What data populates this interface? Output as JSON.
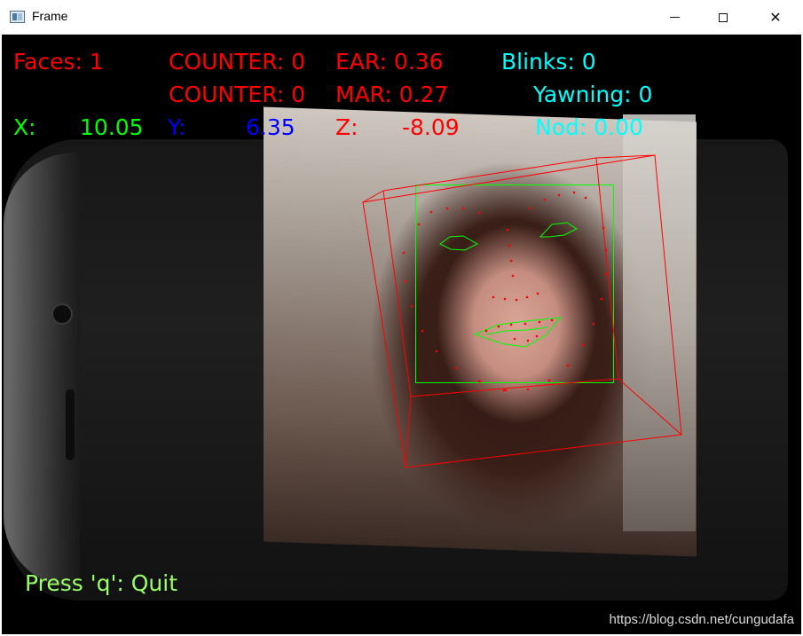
{
  "window": {
    "title": "Frame",
    "minimize_label": "minimize",
    "maximize_label": "maximize",
    "close_label": "✕"
  },
  "overlay": {
    "faces": "Faces: 1",
    "counter_ear": "COUNTER: 0",
    "ear": "EAR: 0.36",
    "blinks": "Blinks: 0",
    "counter_mar": "COUNTER: 0",
    "mar": "MAR: 0.27",
    "yawning": "Yawning: 0",
    "x_label": "X:",
    "x_value": "10.05",
    "y_label": "Y:",
    "y_value": "6.35",
    "z_label": "Z:",
    "z_value": "-8.09",
    "nod": "Nod: 0.00",
    "quit_hint": "Press 'q': Quit"
  },
  "watermark": "https://blog.csdn.net/cungudafa",
  "colors": {
    "red": "#ff0000",
    "green": "#00ff00",
    "blue": "#0000ff",
    "cyan": "#00ffff",
    "light_green": "#99ff66",
    "landmark_red": "#ff0000"
  }
}
